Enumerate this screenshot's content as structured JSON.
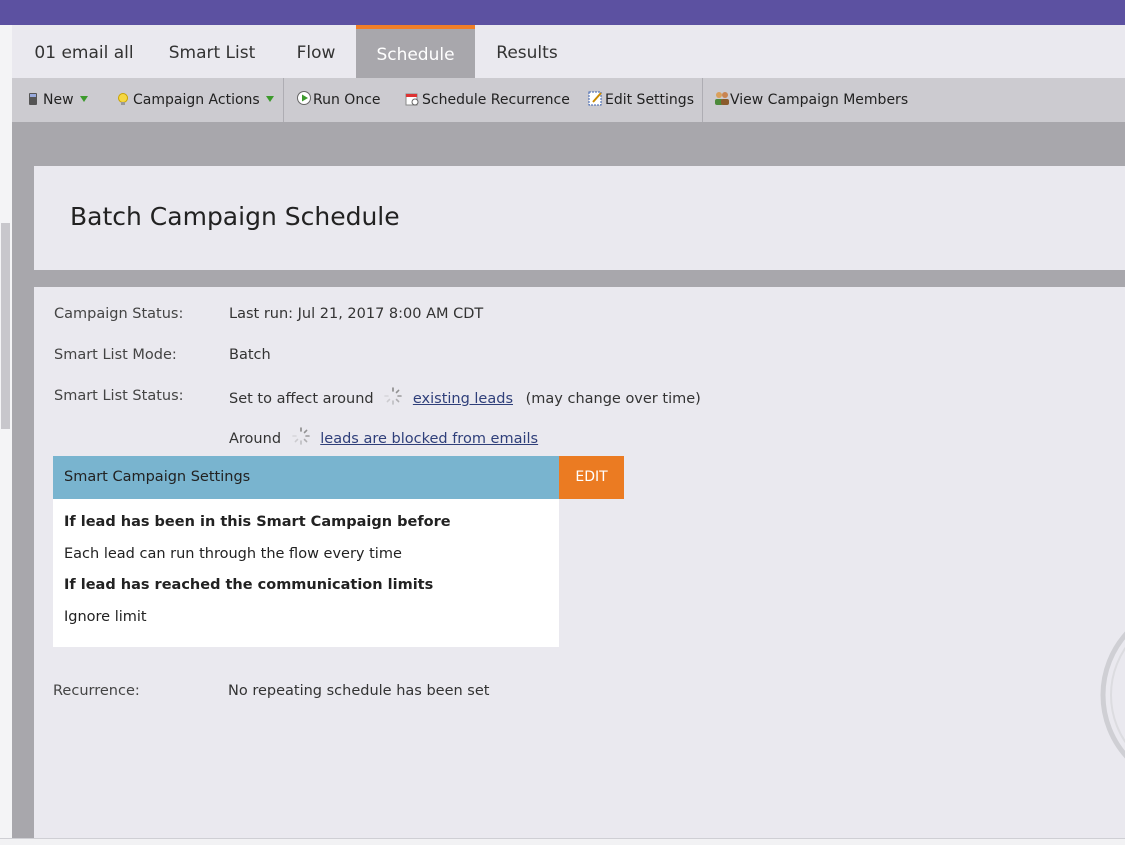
{
  "tabs": [
    {
      "label": "01 email all",
      "active": false
    },
    {
      "label": "Smart List",
      "active": false
    },
    {
      "label": "Flow",
      "active": false
    },
    {
      "label": "Schedule",
      "active": true
    },
    {
      "label": "Results",
      "active": false
    }
  ],
  "toolbar": {
    "new_label": "New",
    "campaign_actions_label": "Campaign Actions",
    "run_once_label": "Run Once",
    "schedule_recurrence_label": "Schedule Recurrence",
    "edit_settings_label": "Edit Settings",
    "view_members_label": "View Campaign Members"
  },
  "page": {
    "title": "Batch Campaign Schedule"
  },
  "details": {
    "campaign_status_label": "Campaign Status:",
    "campaign_status_value": "Last run: Jul 21, 2017 8:00 AM CDT",
    "smart_list_mode_label": "Smart List Mode:",
    "smart_list_mode_value": "Batch",
    "smart_list_status_label": "Smart List Status:",
    "affect_prefix": "Set to affect around",
    "existing_leads_link": "existing leads",
    "affect_suffix": "(may change over time)",
    "around_prefix": "Around",
    "blocked_link": "leads are blocked from emails",
    "recurrence_label": "Recurrence:",
    "recurrence_value": "No repeating schedule has been set"
  },
  "settings": {
    "header": "Smart Campaign Settings",
    "edit_label": "EDIT",
    "q1": "If lead has been in this Smart Campaign before",
    "a1": "Each lead can run through the flow every time",
    "q2": "If lead has reached the communication limits",
    "a2": "Ignore limit"
  },
  "colors": {
    "topbar": "#5c51a1",
    "accent_orange": "#eb7b22",
    "settings_header": "#79b4cf"
  }
}
